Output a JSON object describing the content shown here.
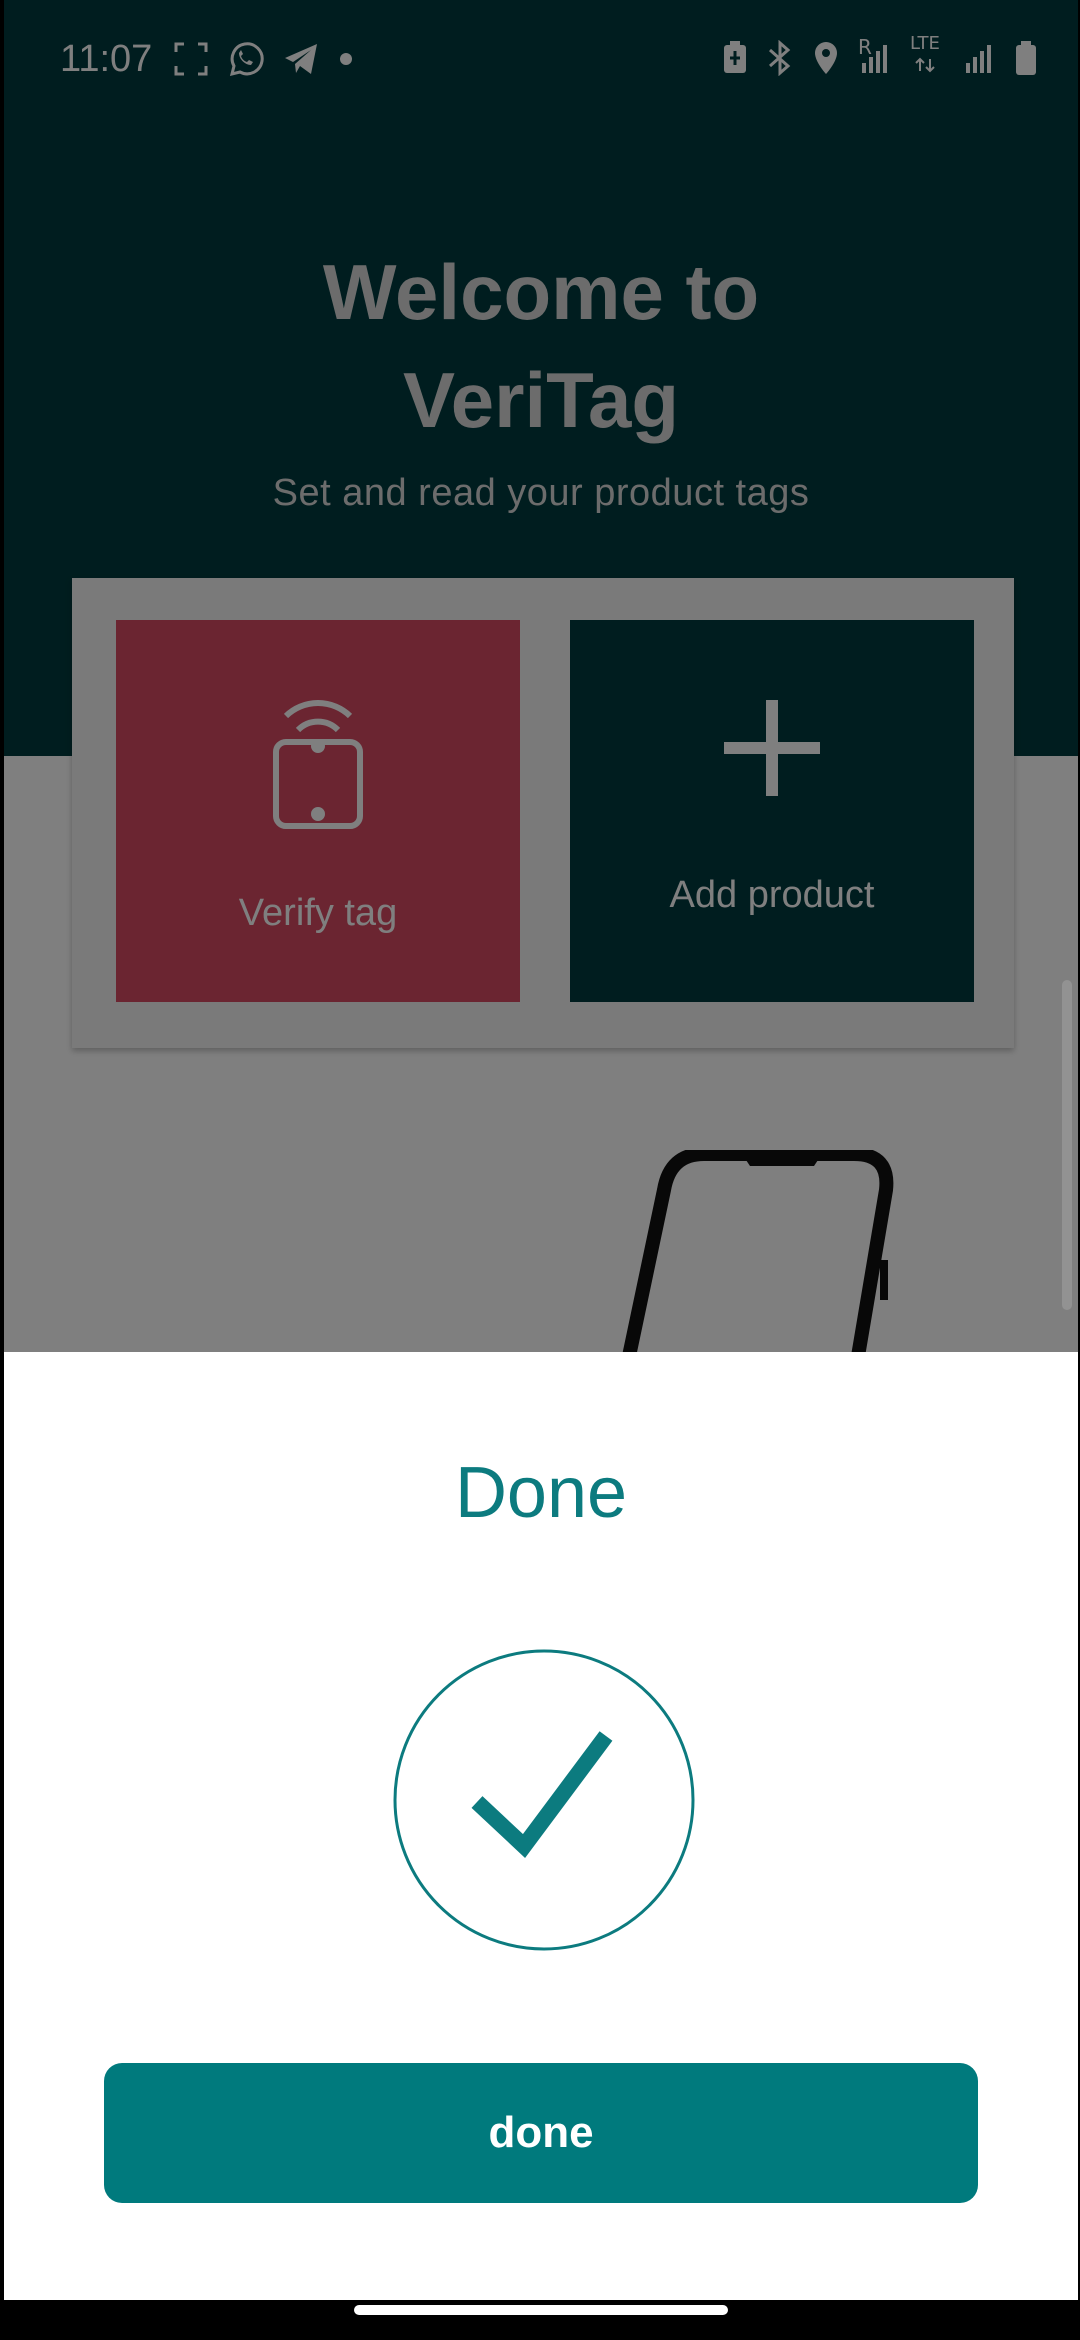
{
  "status_bar": {
    "time": "11:07",
    "left_icons": [
      "screenshot-icon",
      "whatsapp-icon",
      "telegram-icon",
      "dot-icon"
    ],
    "right_icons": [
      "battery-saver-icon",
      "bluetooth-icon",
      "location-icon",
      "signal-r-icon",
      "lte-icon",
      "signal-icon",
      "battery-icon"
    ],
    "signal_label_r": "R",
    "lte_label": "LTE"
  },
  "home": {
    "welcome_line1": "Welcome to",
    "welcome_line2": "VeriTag",
    "subtitle": "Set and read your product tags",
    "cards": [
      {
        "label": "Verify tag",
        "icon": "nfc-phone-icon",
        "color": "#d64a63"
      },
      {
        "label": "Add product",
        "icon": "plus-icon",
        "color": "#003b3e"
      }
    ]
  },
  "sheet": {
    "title": "Done",
    "icon": "check-circle-icon",
    "button_label": "done"
  },
  "colors": {
    "hero_bg": "#003b3e",
    "accent": "#007a7d",
    "title_color": "#0c7b7f",
    "verify_card": "#d64a63"
  }
}
